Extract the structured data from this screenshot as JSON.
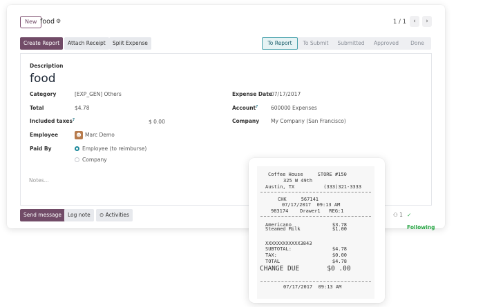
{
  "header": {
    "new_label": "New",
    "record_name": "food",
    "gear_icon": "gear-icon",
    "pager": "1 / 1",
    "prev_icon": "‹",
    "next_icon": "›"
  },
  "actions": {
    "create_report": "Create Report",
    "attach_receipt": "Attach Receipt",
    "split_expense": "Split Expense"
  },
  "status": {
    "stages": [
      "To Report",
      "To Submit",
      "Submitted",
      "Approved",
      "Done"
    ],
    "active": "To Report"
  },
  "form": {
    "description_label": "Description",
    "description": "food",
    "category_label": "Category",
    "category": "[EXP_GEN] Others",
    "total_label": "Total",
    "total": "$4.78",
    "included_taxes_label": "Included taxes",
    "included_taxes_help": "?",
    "included_taxes": "$ 0.00",
    "employee_label": "Employee",
    "employee": "Marc Demo",
    "paid_by_label": "Paid By",
    "paid_by_options": [
      "Employee (to reimburse)",
      "Company"
    ],
    "paid_by_selected": "Employee (to reimburse)",
    "expense_date_label": "Expense Date",
    "expense_date": "07/17/2017",
    "account_label": "Account",
    "account_help": "?",
    "account": "600000 Expenses",
    "company_label": "Company",
    "company": "My Company (San Francisco)",
    "notes_placeholder": "Notes..."
  },
  "chatter": {
    "send_message": "Send message",
    "log_note": "Log note",
    "activities": "Activities",
    "followers_count": "1",
    "following": "Following"
  },
  "receipt": {
    "line1": "Coffee House     STORE #150",
    "line2": "325 W 49th",
    "line3": "Austin, TX          (333)321-3333",
    "line4": "CHK     567141",
    "line5": "07/17/2017  09:13 AM",
    "line6": "983174    Drawer1   REG:1",
    "line7": "Americano              $3.78",
    "line8": "Steamed Milk           $1.00",
    "line9": "XXXXXXXXXXXX3843",
    "line10": "SUBTOTAL:              $4.78",
    "line11": "TAX:                   $0.00",
    "line12": "TOTAL                  $4.78",
    "line13": "CHANGE DUE       $0 .00",
    "line14": "07/17/2017  09:13 AM"
  },
  "colors": {
    "primary": "#714b67",
    "active_stage": "#4aa3ad",
    "following": "#28a745"
  }
}
